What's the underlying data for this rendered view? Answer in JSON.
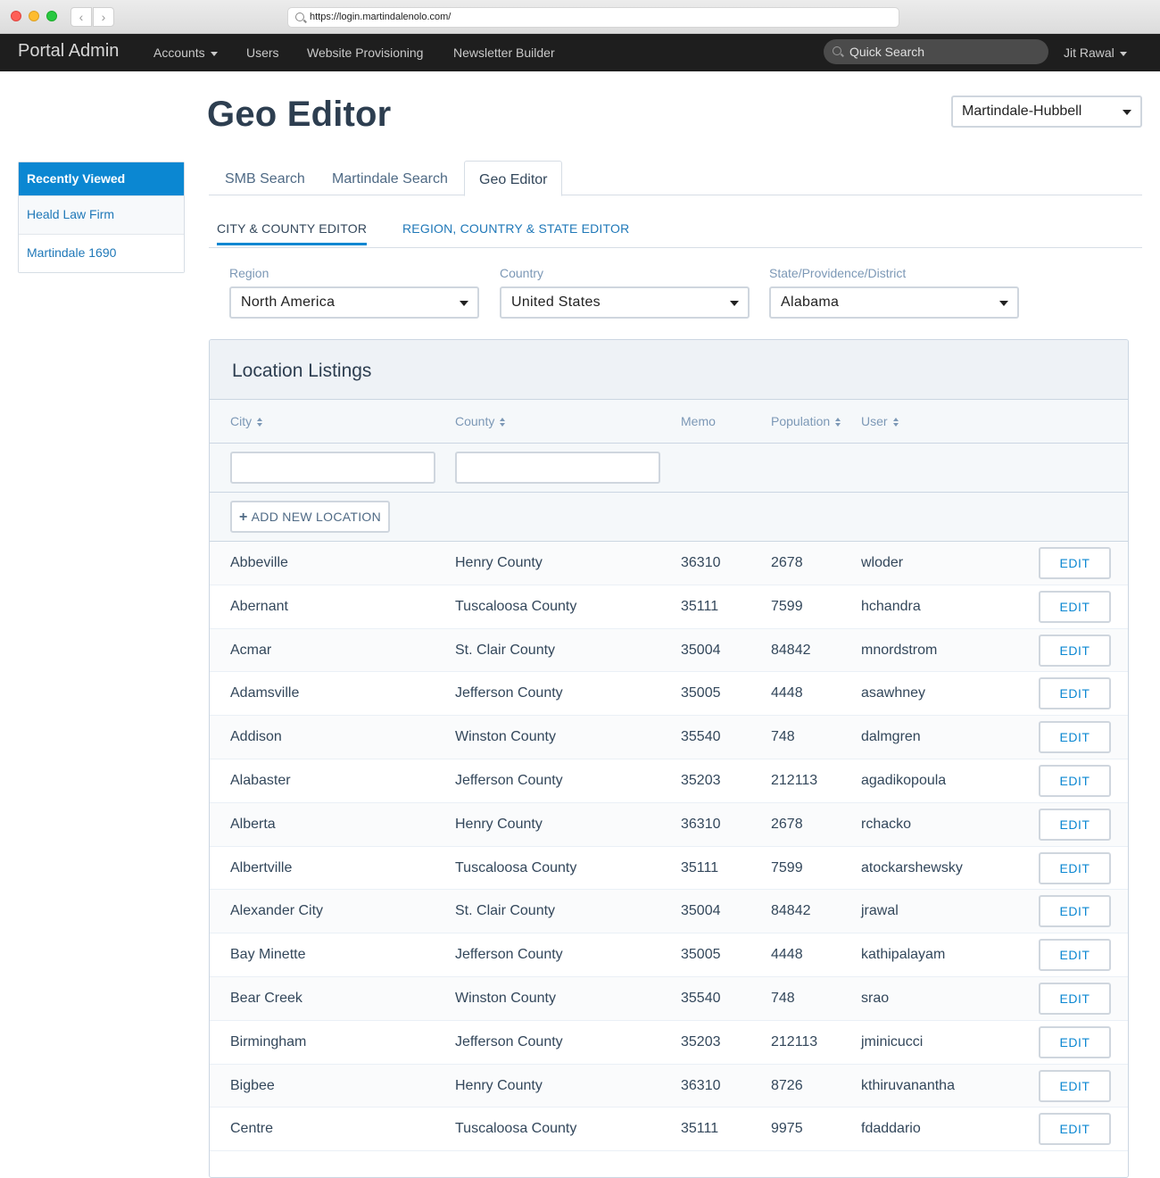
{
  "browser": {
    "url": "https://login.martindalenolo.com/"
  },
  "topnav": {
    "brand": "Portal Admin",
    "items": [
      "Accounts",
      "Users",
      "Website Provisioning",
      "Newsletter Builder"
    ],
    "search_placeholder": "Quick Search",
    "user": "Jit Rawal"
  },
  "page": {
    "title": "Geo Editor",
    "org_select": "Martindale-Hubbell"
  },
  "sidebar": {
    "heading": "Recently Viewed",
    "items": [
      "Heald Law Firm",
      "Martindale 1690"
    ]
  },
  "tabs": [
    "SMB Search",
    "Martindale Search",
    "Geo Editor"
  ],
  "active_tab": "Geo Editor",
  "subtabs": [
    "CITY & COUNTY EDITOR",
    "REGION, COUNTRY & STATE EDITOR"
  ],
  "filters": {
    "region": {
      "label": "Region",
      "value": "North America"
    },
    "country": {
      "label": "Country",
      "value": "United States"
    },
    "state": {
      "label": "State/Providence/District",
      "value": "Alabama"
    }
  },
  "listings": {
    "title": "Location Listings",
    "columns": [
      "City",
      "County",
      "Memo",
      "Population",
      "User"
    ],
    "add_label": "ADD NEW LOCATION",
    "edit_label": "EDIT",
    "rows": [
      [
        "Abbeville",
        "Henry County",
        "36310",
        "2678",
        "wloder"
      ],
      [
        "Abernant",
        "Tuscaloosa County",
        "35111",
        "7599",
        "hchandra"
      ],
      [
        "Acmar",
        "St. Clair County",
        "35004",
        "84842",
        "mnordstrom"
      ],
      [
        "Adamsville",
        "Jefferson County",
        "35005",
        "4448",
        "asawhney"
      ],
      [
        "Addison",
        "Winston County",
        "35540",
        "748",
        "dalmgren"
      ],
      [
        "Alabaster",
        "Jefferson County",
        "35203",
        "212113",
        "agadikopoula"
      ],
      [
        "Alberta",
        "Henry County",
        "36310",
        "2678",
        "rchacko"
      ],
      [
        "Albertville",
        "Tuscaloosa County",
        "35111",
        "7599",
        "atockarshewsky"
      ],
      [
        "Alexander City",
        "St. Clair County",
        "35004",
        "84842",
        "jrawal"
      ],
      [
        "Bay Minette",
        "Jefferson County",
        "35005",
        "4448",
        "kathipalayam"
      ],
      [
        "Bear Creek",
        "Winston County",
        "35540",
        "748",
        "srao"
      ],
      [
        "Birmingham",
        "Jefferson County",
        "35203",
        "212113",
        "jminicucci"
      ],
      [
        "Bigbee",
        "Henry County",
        "36310",
        "8726",
        "kthiruvanantha"
      ],
      [
        "Centre",
        "Tuscaloosa County",
        "35111",
        "9975",
        "fdaddario"
      ]
    ]
  }
}
